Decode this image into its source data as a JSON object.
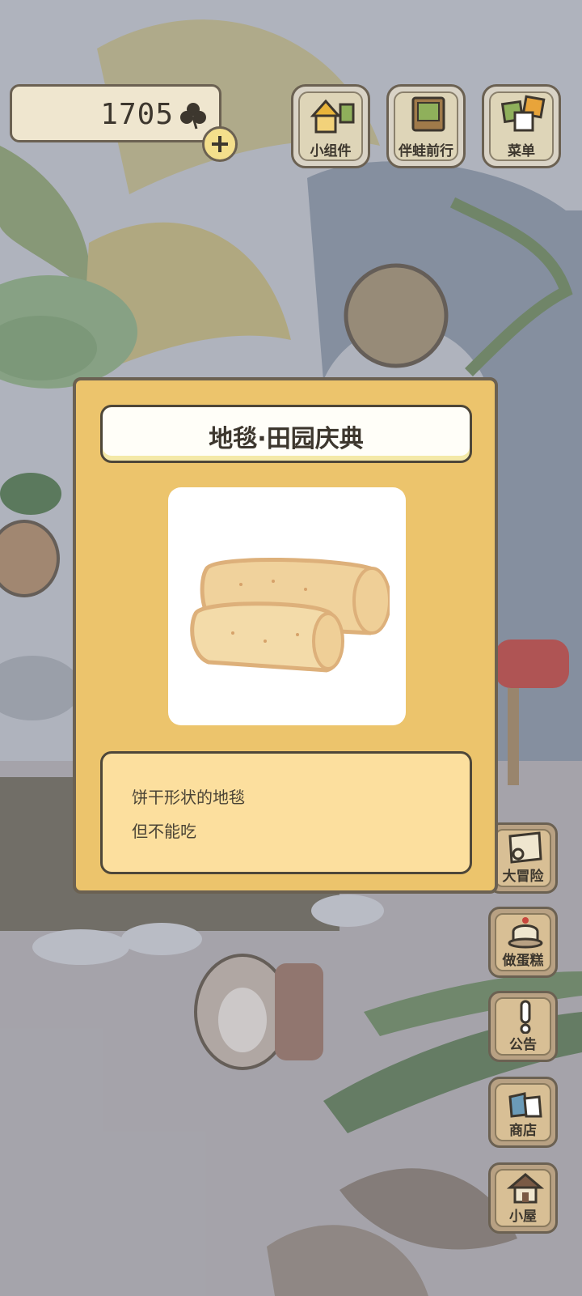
{
  "counter": {
    "value": "1705",
    "icon": "clover-icon"
  },
  "top_buttons": [
    {
      "label": "小组件",
      "icon": "widget-icon"
    },
    {
      "label": "伴蛙前行",
      "icon": "book-icon"
    },
    {
      "label": "菜单",
      "icon": "menu-cards-icon"
    }
  ],
  "dialog": {
    "title": "地毯·田园庆典",
    "item_icon": "biscuit-rug-icon",
    "description": [
      "饼干形状的地毯",
      "但不能吃"
    ]
  },
  "side_buttons": [
    {
      "label": "大冒险",
      "icon": "map-icon"
    },
    {
      "label": "做蛋糕",
      "icon": "cake-icon"
    },
    {
      "label": "公告",
      "icon": "exclamation-icon"
    },
    {
      "label": "商店",
      "icon": "shop-bags-icon"
    },
    {
      "label": "小屋",
      "icon": "house-icon"
    }
  ],
  "colors": {
    "dialog_bg": "#ecc46c",
    "desc_bg": "#fcdf9e",
    "border": "#4e4739"
  }
}
